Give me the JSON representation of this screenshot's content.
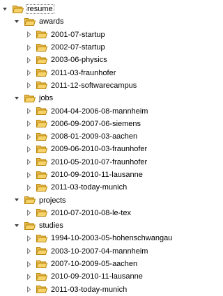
{
  "tree": [
    {
      "label": "resume",
      "level": 0,
      "expanded": true,
      "selected": true
    },
    {
      "label": "awards",
      "level": 1,
      "expanded": true
    },
    {
      "label": "2001-07-startup",
      "level": 2,
      "expanded": false
    },
    {
      "label": "2002-07-startup",
      "level": 2,
      "expanded": false
    },
    {
      "label": "2003-06-physics",
      "level": 2,
      "expanded": false
    },
    {
      "label": "2011-03-fraunhofer",
      "level": 2,
      "expanded": false
    },
    {
      "label": "2011-12-softwarecampus",
      "level": 2,
      "expanded": false
    },
    {
      "label": "jobs",
      "level": 1,
      "expanded": true
    },
    {
      "label": "2004-04-2006-08-mannheim",
      "level": 2,
      "expanded": false
    },
    {
      "label": "2006-09-2007-06-siemens",
      "level": 2,
      "expanded": false
    },
    {
      "label": "2008-01-2009-03-aachen",
      "level": 2,
      "expanded": false
    },
    {
      "label": "2009-06-2010-03-fraunhofer",
      "level": 2,
      "expanded": false
    },
    {
      "label": "2010-05-2010-07-fraunhofer",
      "level": 2,
      "expanded": false
    },
    {
      "label": "2010-09-2010-11-lausanne",
      "level": 2,
      "expanded": false
    },
    {
      "label": "2011-03-today-munich",
      "level": 2,
      "expanded": false
    },
    {
      "label": "projects",
      "level": 1,
      "expanded": true
    },
    {
      "label": "2010-07-2010-08-le-tex",
      "level": 2,
      "expanded": false
    },
    {
      "label": "studies",
      "level": 1,
      "expanded": true
    },
    {
      "label": "1994-10-2003-05-hohenschwangau",
      "level": 2,
      "expanded": false
    },
    {
      "label": "2003-10-2007-04-mannheim",
      "level": 2,
      "expanded": false
    },
    {
      "label": "2007-10-2009-05-aachen",
      "level": 2,
      "expanded": false
    },
    {
      "label": "2010-09-2010-11-lausanne",
      "level": 2,
      "expanded": false
    },
    {
      "label": "2011-03-today-munich",
      "level": 2,
      "expanded": false
    }
  ],
  "icons": {
    "expanded": "triangle-down-icon",
    "collapsed": "triangle-right-icon",
    "folder": "folder-icon"
  },
  "colors": {
    "folder_fill": "#f6d26b",
    "folder_stroke": "#b8860b",
    "toggle_expanded": "#404040",
    "toggle_collapsed": "#808080"
  }
}
